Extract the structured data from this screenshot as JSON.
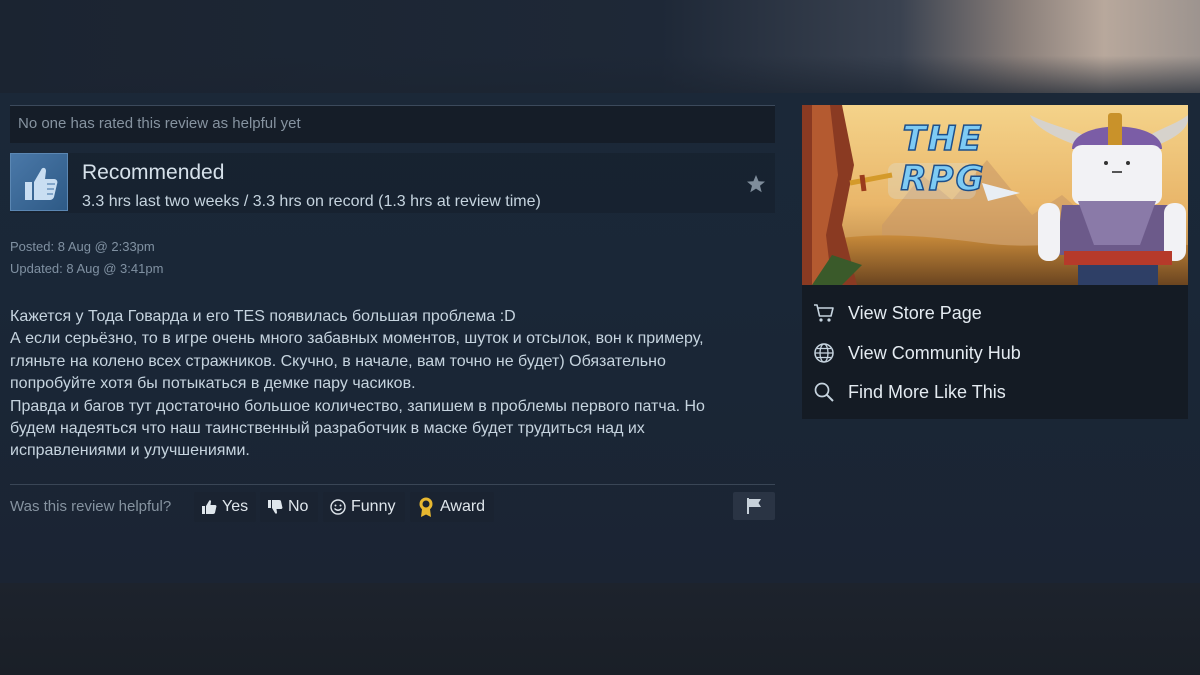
{
  "review": {
    "helpful_status": "No one has rated this review as helpful yet",
    "recommendation": "Recommended",
    "hours": "3.3 hrs last two weeks / 3.3 hrs on record (1.3 hrs at review time)",
    "posted": "Posted: 8 Aug @ 2:33pm",
    "updated": "Updated: 8 Aug @ 3:41pm",
    "body_lines": [
      "Кажется у Тода Говарда и его TES появилась большая проблема :D",
      "А если серьёзно, то в игре очень много забавных моментов, шуток и отсылок, вон к примеру,",
      "гляньте на колено всех стражников. Скучно, в начале, вам точно не будет) Обязательно",
      "попробуйте хотя бы потыкаться в демке пару часиков.",
      "Правда и багов тут достаточно большое количество, запишем в проблемы первого патча. Но",
      "будем надеяться что наш таинственный разработчик в маске будет трудиться над их",
      "исправлениями и улучшениями."
    ]
  },
  "vote": {
    "question": "Was this review helpful?",
    "yes": "Yes",
    "no": "No",
    "funny": "Funny",
    "award": "Award"
  },
  "sidebar": {
    "banner_logo": "THE RPG",
    "links": [
      {
        "label": "View Store Page",
        "icon": "cart-icon"
      },
      {
        "label": "View Community Hub",
        "icon": "globe-icon"
      },
      {
        "label": "Find More Like This",
        "icon": "search-icon"
      }
    ]
  },
  "colors": {
    "background": "#1b2838",
    "panel": "#141b24",
    "text": "#c6d4df",
    "muted": "#8693a0",
    "thumb_blue": "#3d6b98",
    "award_gold": "#e8b830"
  }
}
